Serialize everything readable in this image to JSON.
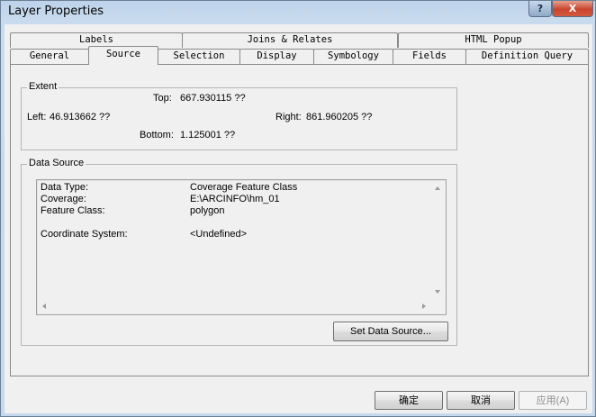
{
  "window": {
    "title": "Layer Properties",
    "help_glyph": "?",
    "close_glyph": "X"
  },
  "tabs": {
    "row1": [
      "Labels",
      "Joins & Relates",
      "HTML Popup"
    ],
    "row2": [
      "General",
      "Source",
      "Selection",
      "Display",
      "Symbology",
      "Fields",
      "Definition Query"
    ],
    "active": "Source"
  },
  "extent": {
    "label": "Extent",
    "top_label": "Top:",
    "top_value": "667.930115 ??",
    "left_label": "Left:",
    "left_value": "46.913662 ??",
    "right_label": "Right:",
    "right_value": "861.960205 ??",
    "bottom_label": "Bottom:",
    "bottom_value": "1.125001 ??"
  },
  "data_source": {
    "label": "Data Source",
    "rows": [
      {
        "key": "Data Type:",
        "value": "Coverage Feature Class"
      },
      {
        "key": "Coverage:",
        "value": "E:\\ARCINFO\\hm_01"
      },
      {
        "key": "Feature Class:",
        "value": "polygon"
      },
      {
        "key": "Coordinate System:",
        "value": "<Undefined>"
      }
    ],
    "set_button": "Set Data Source..."
  },
  "footer": {
    "ok": "确定",
    "cancel": "取消",
    "apply": "应用(A)"
  },
  "colors": {
    "title_bar": "#c5d8ec",
    "close_button": "#c9452e",
    "dialog_face": "#f0f0f0"
  }
}
